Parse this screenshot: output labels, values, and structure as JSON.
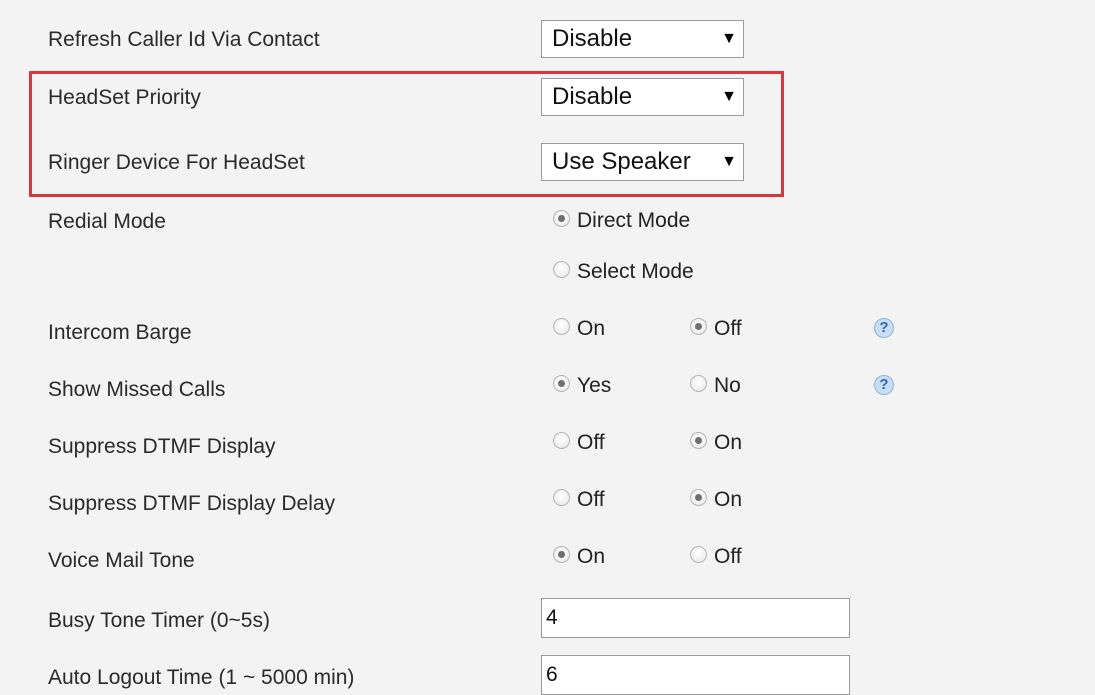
{
  "rows": {
    "refresh_caller_id": {
      "label": "Refresh Caller Id Via Contact",
      "value": "Disable"
    },
    "headset_priority": {
      "label": "HeadSet Priority",
      "value": "Disable"
    },
    "ringer_device": {
      "label": "Ringer Device For HeadSet",
      "value": "Use Speaker"
    },
    "redial_mode": {
      "label": "Redial Mode",
      "option1": "Direct Mode",
      "option2": "Select Mode",
      "selected": "Direct Mode"
    },
    "intercom_barge": {
      "label": "Intercom Barge",
      "option1": "On",
      "option2": "Off",
      "selected": "Off"
    },
    "show_missed_calls": {
      "label": "Show Missed Calls",
      "option1": "Yes",
      "option2": "No",
      "selected": "Yes"
    },
    "suppress_dtmf_display": {
      "label": "Suppress DTMF Display",
      "option1": "Off",
      "option2": "On",
      "selected": "On"
    },
    "suppress_dtmf_display_delay": {
      "label": "Suppress DTMF Display Delay",
      "option1": "Off",
      "option2": "On",
      "selected": "On"
    },
    "voice_mail_tone": {
      "label": "Voice Mail Tone",
      "option1": "On",
      "option2": "Off",
      "selected": "On"
    },
    "busy_tone_timer": {
      "label": "Busy Tone Timer (0~5s)",
      "value": "4"
    },
    "auto_logout_time": {
      "label": "Auto Logout Time (1 ~ 5000 min)",
      "value": "6"
    }
  },
  "select_arrow": "▼",
  "help_icon": "?",
  "colors": {
    "highlight": "#d9373f",
    "help": "#2f69ad"
  }
}
